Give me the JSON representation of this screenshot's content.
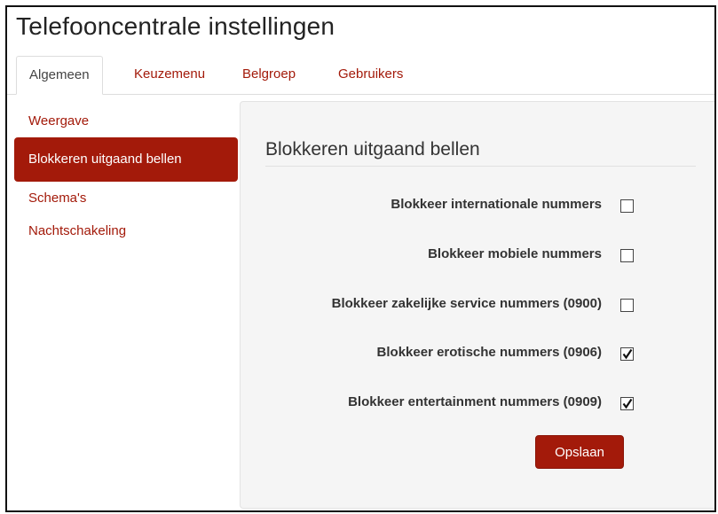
{
  "page": {
    "title": "Telefooncentrale instellingen"
  },
  "tabs": [
    {
      "label": "Algemeen",
      "active": true
    },
    {
      "label": "Keuzemenu",
      "active": false
    },
    {
      "label": "Belgroep",
      "active": false
    },
    {
      "label": "Gebruikers",
      "active": false
    }
  ],
  "sidebar": {
    "items": [
      {
        "label": "Weergave",
        "active": false
      },
      {
        "label": "Blokkeren uitgaand bellen",
        "active": true
      },
      {
        "label": "Schema's",
        "active": false
      },
      {
        "label": "Nachtschakeling",
        "active": false
      }
    ]
  },
  "panel": {
    "title": "Blokkeren uitgaand bellen",
    "options": [
      {
        "label": "Blokkeer internationale nummers",
        "checked": false
      },
      {
        "label": "Blokkeer mobiele nummers",
        "checked": false
      },
      {
        "label": "Blokkeer zakelijke service nummers (0900)",
        "checked": false
      },
      {
        "label": "Blokkeer erotische nummers (0906)",
        "checked": true
      },
      {
        "label": "Blokkeer entertainment nummers (0909)",
        "checked": true
      }
    ],
    "save_label": "Opslaan"
  },
  "colors": {
    "accent": "#a31a0a",
    "panel_bg": "#f5f5f5"
  }
}
